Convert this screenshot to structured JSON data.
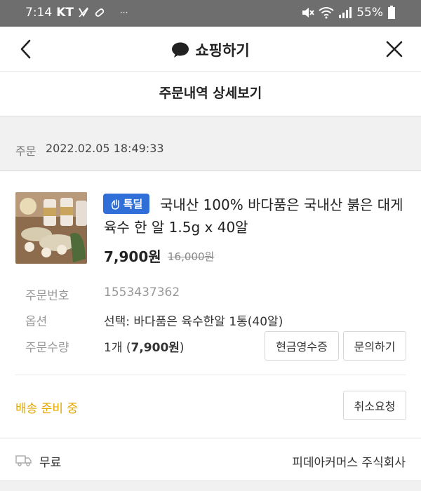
{
  "status_bar": {
    "time": "7:14",
    "carrier": "KT",
    "more": "···",
    "battery": "55%"
  },
  "app_bar": {
    "title": "쇼핑하기",
    "icons": [
      "chevron-left-icon",
      "chat-bubble-icon",
      "close-icon"
    ]
  },
  "page": {
    "title": "주문내역 상세보기"
  },
  "order": {
    "date_label": "주문",
    "date_value": "2022.02.05 18:49:33"
  },
  "product": {
    "badge": "톡딜",
    "badge_icon": "wave-hand-icon",
    "name": "국내산 100% 바다품은 국내산 붉은 대게 육수 한 알 1.5g x 40알",
    "price": "7,900원",
    "original_price": "16,000원"
  },
  "details": {
    "order_no_label": "주문번호",
    "order_no_value": "1553437362",
    "option_label": "옵션",
    "option_value": "선택: 바다품은 육수한알 1통(40알)",
    "qty_label": "주문수량",
    "qty_count": "1개 (",
    "qty_price": "7,900원",
    "qty_close": ")"
  },
  "buttons": {
    "receipt": "현금영수증",
    "inquiry": "문의하기",
    "cancel": "취소요청"
  },
  "shipping": {
    "status": "배송 준비 중",
    "status_color": "#e6a800",
    "fee": "무료",
    "seller": "피데아커머스 주식회사"
  },
  "colors": {
    "status_bar": "#6e6e6e",
    "badge": "#2f6fd7",
    "section_bg": "#f1f1f1"
  }
}
